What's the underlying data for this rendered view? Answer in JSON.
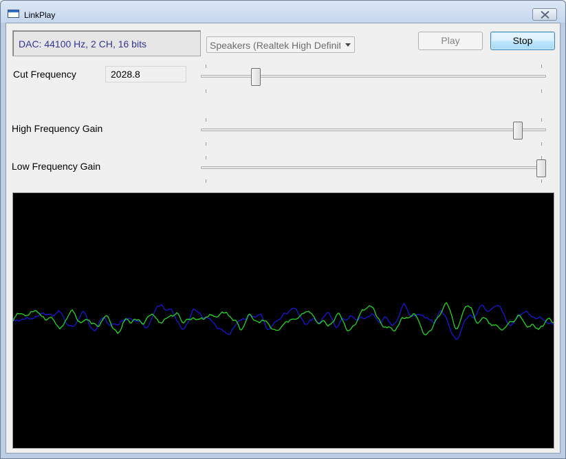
{
  "window": {
    "title": "LinkPlay"
  },
  "dac": {
    "text": "DAC: 44100 Hz, 2 CH, 16 bits"
  },
  "output_device": {
    "selected": "Speakers (Realtek High Definition Audio)"
  },
  "buttons": {
    "play_label": "Play",
    "stop_label": "Stop"
  },
  "cut_frequency": {
    "label": "Cut Frequency",
    "value": "2028.8",
    "slider_fraction": 0.15
  },
  "high_gain": {
    "label": "High Frequency Gain",
    "slider_fraction": 0.93
  },
  "low_gain": {
    "label": "Low Frequency Gain",
    "slider_fraction": 1.0
  },
  "oscilloscope": {
    "channel_colors": [
      "#1a1ae6",
      "#22e622"
    ],
    "background": "#000000"
  }
}
